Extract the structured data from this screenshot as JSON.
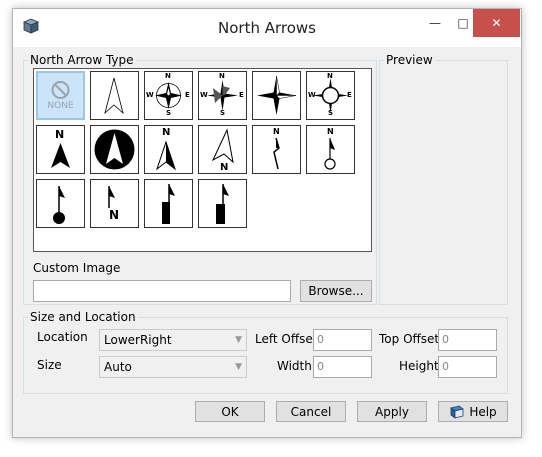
{
  "window": {
    "title": "North Arrows",
    "minimize_glyph": "—",
    "maximize_glyph": "□",
    "close_glyph": "✕"
  },
  "arrow_type": {
    "label": "North Arrow Type",
    "none_label": "NONE",
    "letters": {
      "n": "N",
      "s": "S",
      "e": "E",
      "w": "W"
    }
  },
  "preview": {
    "label": "Preview"
  },
  "custom_image": {
    "label": "Custom Image",
    "value": "",
    "browse_label": "Browse..."
  },
  "size_location": {
    "label": "Size and Location",
    "location_label": "Location",
    "location_value": "LowerRight",
    "size_label": "Size",
    "size_value": "Auto",
    "left_offset_label": "Left Offset:",
    "left_offset_value": "0",
    "top_offset_label": "Top Offset:",
    "top_offset_value": "0",
    "width_label": "Width:",
    "width_value": "0",
    "height_label": "Height:",
    "height_value": "0"
  },
  "buttons": {
    "ok": "OK",
    "cancel": "Cancel",
    "apply": "Apply",
    "help": "Help"
  }
}
